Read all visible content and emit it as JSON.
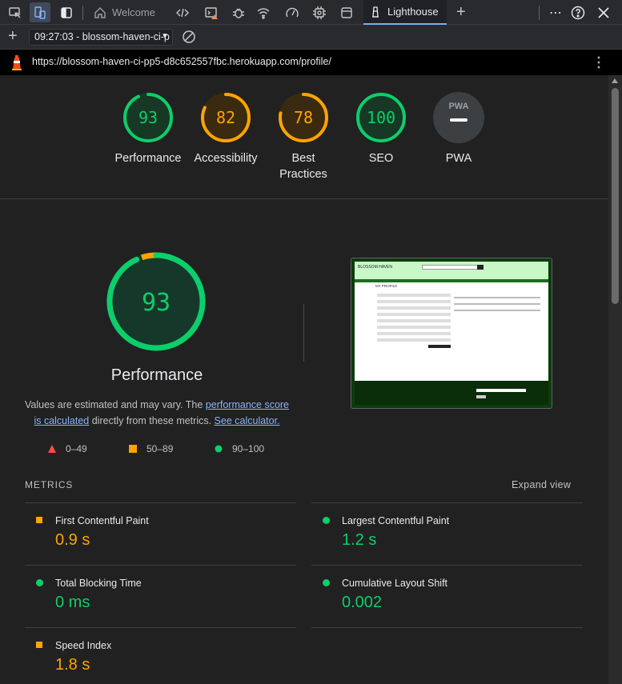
{
  "devtools": {
    "tabs": [
      {
        "label": "Welcome",
        "icon": "home-icon"
      },
      {
        "label": "Lighthouse",
        "icon": "lighthouse-icon",
        "selected": true
      }
    ],
    "add_tab": "+",
    "more": "⋯",
    "help": "?",
    "close": "✕"
  },
  "toolbar": {
    "report_select": "09:27:03 - blossom-haven-ci-p",
    "caret": "▼",
    "new_report": "+"
  },
  "url": "https://blossom-haven-ci-pp5-d8c652557fbc.herokuapp.com/profile/",
  "colors": {
    "pass": "#0cce6b",
    "average": "#ffa400",
    "fail": "#ff4e42",
    "link": "#8ab4f8"
  },
  "categories": [
    {
      "score": "93",
      "label": "Performance",
      "status": "pass",
      "fraction": 0.93
    },
    {
      "score": "82",
      "label": "Accessibility",
      "status": "average",
      "fraction": 0.82
    },
    {
      "score": "78",
      "label": "Best Practices",
      "status": "average",
      "fraction": 0.78
    },
    {
      "score": "100",
      "label": "SEO",
      "status": "pass",
      "fraction": 1.0
    },
    {
      "score": "",
      "label": "PWA",
      "status": "na",
      "badge": "PWA"
    }
  ],
  "performance": {
    "score": "93",
    "title": "Performance",
    "desc_prefix": "Values are estimated and may vary. The ",
    "desc_link1": "performance score is calculated",
    "desc_mid": " directly from these metrics. ",
    "desc_link2": "See calculator."
  },
  "legend": [
    {
      "shape": "triangle",
      "range": "0–49"
    },
    {
      "shape": "square",
      "range": "50–89"
    },
    {
      "shape": "circle",
      "range": "90–100"
    }
  ],
  "thumbnail": {
    "brand": "BLOSSOM HAVEN",
    "heading": "MY PROFILE"
  },
  "metrics": {
    "title": "METRICS",
    "expand": "Expand view",
    "items": [
      {
        "name": "First Contentful Paint",
        "value": "0.9 s",
        "status": "average"
      },
      {
        "name": "Largest Contentful Paint",
        "value": "1.2 s",
        "status": "pass"
      },
      {
        "name": "Total Blocking Time",
        "value": "0 ms",
        "status": "pass"
      },
      {
        "name": "Cumulative Layout Shift",
        "value": "0.002",
        "status": "pass"
      },
      {
        "name": "Speed Index",
        "value": "1.8 s",
        "status": "average"
      }
    ]
  }
}
